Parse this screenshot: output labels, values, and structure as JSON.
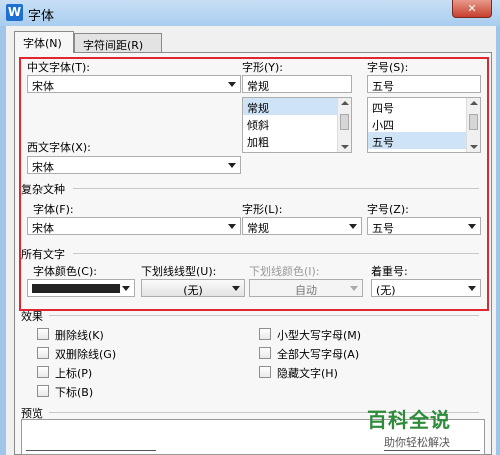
{
  "window": {
    "title": "字体",
    "app_icon_letter": "W",
    "close_glyph": "✕"
  },
  "tabs": [
    "字体(N)",
    "字符间距(R)"
  ],
  "chinese_font": {
    "label": "中文字体(T):",
    "value": "宋体"
  },
  "western_font": {
    "label": "西文字体(X):",
    "value": "宋体"
  },
  "style": {
    "label": "字形(Y):",
    "value": "常规",
    "options": [
      "常规",
      "倾斜",
      "加粗"
    ],
    "selected": "常规"
  },
  "size": {
    "label": "字号(S):",
    "value": "五号",
    "options": [
      "四号",
      "小四",
      "五号"
    ],
    "selected": "五号"
  },
  "complex": {
    "heading": "复杂文种",
    "font_label": "字体(F):",
    "font_value": "宋体",
    "style_label": "字形(L):",
    "style_value": "常规",
    "size_label": "字号(Z):",
    "size_value": "五号"
  },
  "all_text": {
    "heading": "所有文字",
    "color_label": "字体颜色(C):",
    "color_value": "#222222",
    "underline_label": "下划线线型(U):",
    "underline_value": "(无)",
    "underline_color_label": "下划线颜色(I):",
    "underline_color_value": "自动",
    "emphasis_label": "着重号:",
    "emphasis_value": "(无)"
  },
  "effects": {
    "heading": "效果",
    "left": [
      "删除线(K)",
      "双删除线(G)",
      "上标(P)",
      "下标(B)"
    ],
    "right": [
      "小型大写字母(M)",
      "全部大写字母(A)",
      "隐藏文字(H)"
    ]
  },
  "preview_label": "预览",
  "watermark": {
    "brand": "百科全说",
    "tagline": "助你轻松解决"
  },
  "colors": {
    "highlight": "#e0262e",
    "selection": "#cfe3f7",
    "watermark_green": "#2e8b3a"
  }
}
